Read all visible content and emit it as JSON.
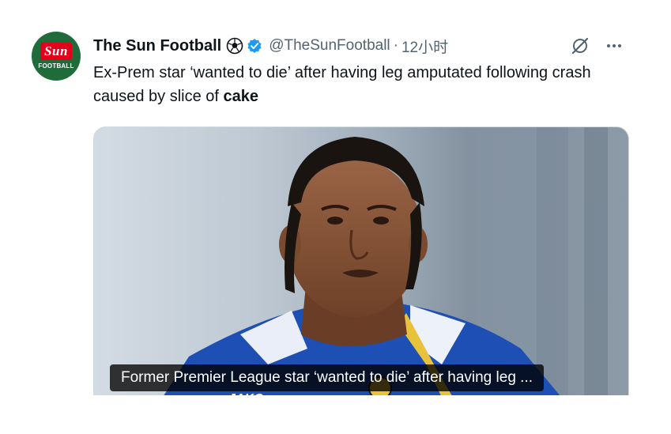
{
  "post": {
    "author_name": "The Sun Football",
    "handle": "@TheSunFootball",
    "separator": "·",
    "time": "12小时",
    "text_part1": "Ex-Prem star ‘wanted to die’ after having leg amputated following crash caused by slice of ",
    "text_bold": "cake",
    "media_caption": "Former Premier League star ‘wanted to die’ after having leg ...",
    "shirt_text": "JAKO"
  },
  "avatar": {
    "logo_main": "Sun",
    "logo_sub": "FOOTBALL"
  },
  "icons": {
    "ball": "soccer-ball-icon",
    "verified": "verified-badge-icon",
    "grok": "grok-icon",
    "more": "more-icon"
  },
  "colors": {
    "verified": "#1d9bf0",
    "avatar_bg": "#1f6b3a",
    "sun_red": "#e3001b",
    "secondary_text": "#536471",
    "kit_blue": "#1e4fb5"
  }
}
